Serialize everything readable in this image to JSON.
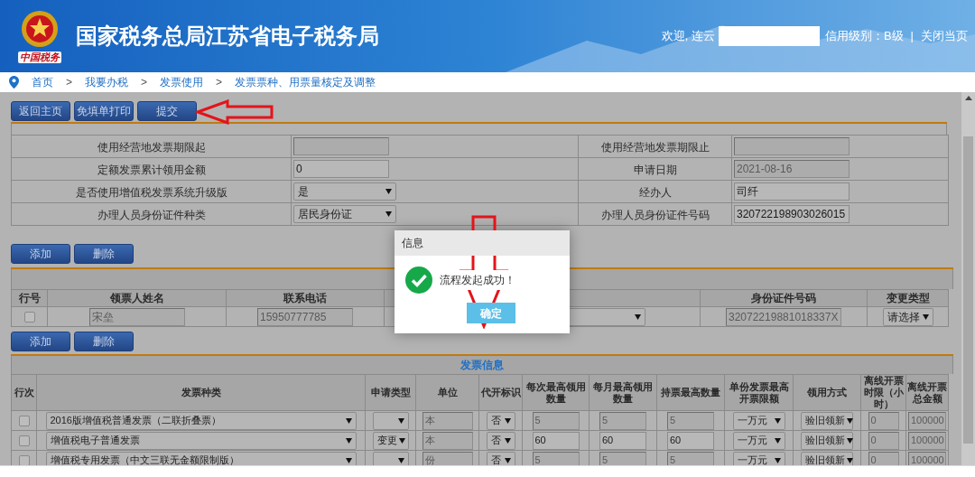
{
  "header": {
    "logo_text": "中国税务",
    "title": "国家税务总局江苏省电子税务局",
    "welcome": "欢迎, 连云",
    "credit": "信用级别：B级",
    "separator": "|",
    "close": "关闭当页"
  },
  "breadcrumb": [
    {
      "kind": "link",
      "label": "首页"
    },
    {
      "kind": "sep",
      "label": ">"
    },
    {
      "kind": "link",
      "label": "我要办税"
    },
    {
      "kind": "sep",
      "label": ">"
    },
    {
      "kind": "link",
      "label": "发票使用"
    },
    {
      "kind": "sep",
      "label": ">"
    },
    {
      "kind": "link",
      "label": "发票票种、用票量核定及调整"
    }
  ],
  "toolbar": [
    "返回主页",
    "免填单打印",
    "提交"
  ],
  "form_rows": [
    {
      "cells": [
        {
          "kind": "label",
          "text": "使用经营地发票期限起"
        },
        {
          "kind": "input",
          "disabled": true
        },
        {
          "kind": "label",
          "text": "使用经营地发票期限止"
        },
        {
          "kind": "input",
          "disabled": true
        }
      ]
    },
    {
      "cells": [
        {
          "kind": "label",
          "text": "定额发票累计领用金额"
        },
        {
          "kind": "input",
          "value": "0",
          "disabled": false
        },
        {
          "kind": "label",
          "text": "申请日期"
        },
        {
          "kind": "input",
          "value": "2021-08-16",
          "disabled": true
        }
      ]
    },
    {
      "cells": [
        {
          "kind": "label",
          "text": "是否使用增值税发票系统升级版"
        },
        {
          "kind": "select",
          "value": "是"
        },
        {
          "kind": "label",
          "text": "经办人"
        },
        {
          "kind": "input",
          "value": "司纤",
          "disabled": false
        }
      ]
    },
    {
      "cells": [
        {
          "kind": "label",
          "text": "办理人员身份证件种类"
        },
        {
          "kind": "select",
          "value": "居民身份证"
        },
        {
          "kind": "label",
          "text": "办理人员身份证件号码"
        },
        {
          "kind": "input",
          "value": "320722198903026015",
          "disabled": false
        }
      ]
    }
  ],
  "recipients": {
    "buttons": [
      "添加",
      "删除"
    ],
    "columns": [
      {
        "label": "行号"
      },
      {
        "label": "领票人姓名"
      },
      {
        "label": "联系电话"
      },
      {},
      {
        "label": "身份证件号码"
      },
      {
        "label": "变更类型"
      }
    ],
    "rows": [
      {
        "cells": [
          {
            "kind": "checkbox",
            "checked": false
          },
          {
            "kind": "input",
            "value": "宋垒",
            "disabled": true
          },
          {
            "kind": "input",
            "value": "15950777785",
            "disabled": true
          },
          {
            "kind": "select"
          },
          {
            "kind": "input",
            "value": "32072219881018337X",
            "disabled": true
          },
          {
            "kind": "select",
            "value": "请选择"
          }
        ]
      }
    ]
  },
  "invoices": {
    "buttons": [
      "添加",
      "删除"
    ],
    "title": "发票信息",
    "columns": [
      {
        "label": "行次"
      },
      {
        "label": "发票种类"
      },
      {
        "label": "申请类型"
      },
      {
        "label": "单位"
      },
      {
        "label": "代开标识"
      },
      {
        "label": "每次最高领用数量"
      },
      {
        "label": "每月最高领用数量"
      },
      {
        "label": "持票最高数量"
      },
      {
        "label": "单份发票最高开票限额"
      },
      {
        "label": "领用方式"
      },
      {
        "label": "离线开票时限（小时）"
      },
      {
        "label": "离线开票总金额"
      }
    ],
    "rows": [
      {
        "cells": [
          {
            "kind": "checkbox",
            "checked": false
          },
          {
            "kind": "select",
            "value": "2016版增值税普通发票（二联折叠票）"
          },
          {
            "kind": "select"
          },
          {
            "kind": "input",
            "value": "本",
            "disabled": true
          },
          {
            "kind": "select",
            "value": "否"
          },
          {
            "kind": "input",
            "value": "5",
            "disabled": true
          },
          {
            "kind": "input",
            "value": "5",
            "disabled": true
          },
          {
            "kind": "input",
            "value": "5",
            "disabled": true
          },
          {
            "kind": "select",
            "value": "一万元"
          },
          {
            "kind": "select",
            "value": "验旧领新"
          },
          {
            "kind": "input",
            "value": "0",
            "disabled": true
          },
          {
            "kind": "input",
            "value": "100000",
            "disabled": true
          }
        ]
      },
      {
        "cells": [
          {
            "kind": "checkbox",
            "checked": false
          },
          {
            "kind": "select",
            "value": "增值税电子普通发票"
          },
          {
            "kind": "select",
            "value": "变更"
          },
          {
            "kind": "input",
            "value": "本",
            "disabled": true
          },
          {
            "kind": "select",
            "value": "否"
          },
          {
            "kind": "input",
            "value": "60",
            "disabled": false
          },
          {
            "kind": "input",
            "value": "60",
            "disabled": false
          },
          {
            "kind": "input",
            "value": "60",
            "disabled": false
          },
          {
            "kind": "select",
            "value": "一万元"
          },
          {
            "kind": "select",
            "value": "验旧领新"
          },
          {
            "kind": "input",
            "value": "0",
            "disabled": true
          },
          {
            "kind": "input",
            "value": "100000",
            "disabled": true
          }
        ]
      },
      {
        "cells": [
          {
            "kind": "checkbox",
            "checked": false
          },
          {
            "kind": "select",
            "value": "增值税专用发票（中文三联无金额限制版）"
          },
          {
            "kind": "select"
          },
          {
            "kind": "input",
            "value": "份",
            "disabled": true
          },
          {
            "kind": "select",
            "value": "否"
          },
          {
            "kind": "input",
            "value": "5",
            "disabled": true
          },
          {
            "kind": "input",
            "value": "5",
            "disabled": true
          },
          {
            "kind": "input",
            "value": "5",
            "disabled": true
          },
          {
            "kind": "select",
            "value": "一万元"
          },
          {
            "kind": "select",
            "value": "验旧领新"
          },
          {
            "kind": "input",
            "value": "0",
            "disabled": true
          },
          {
            "kind": "input",
            "value": "100000",
            "disabled": true
          }
        ]
      }
    ]
  },
  "dialog": {
    "title": "信息",
    "message": "流程发起成功！",
    "button": "确定"
  }
}
